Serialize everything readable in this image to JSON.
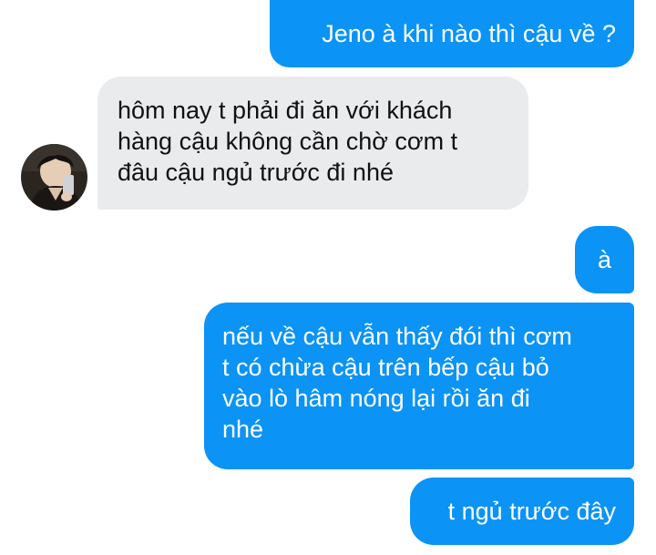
{
  "conversation": {
    "contact": {
      "avatar_icon": "contact-avatar-photo"
    },
    "colors": {
      "sent_bubble": "#0b93f6",
      "sent_text": "#ffffff",
      "received_bubble": "#eaebed",
      "received_text": "#111111"
    },
    "messages": [
      {
        "direction": "sent",
        "text": "Jeno à khi nào thì cậu về ?"
      },
      {
        "direction": "received",
        "text": "hôm nay t phải đi ăn với khách\nhàng cậu không cần chờ cơm t\nđâu cậu ngủ trước đi nhé"
      },
      {
        "direction": "sent",
        "text": "à"
      },
      {
        "direction": "sent",
        "text": "nếu về cậu vẫn thấy đói thì cơm\nt có chừa cậu trên bếp cậu bỏ\nvào lò hâm nóng lại rồi ăn đi\nnhé"
      },
      {
        "direction": "sent",
        "text": "t ngủ trước đây"
      }
    ]
  }
}
